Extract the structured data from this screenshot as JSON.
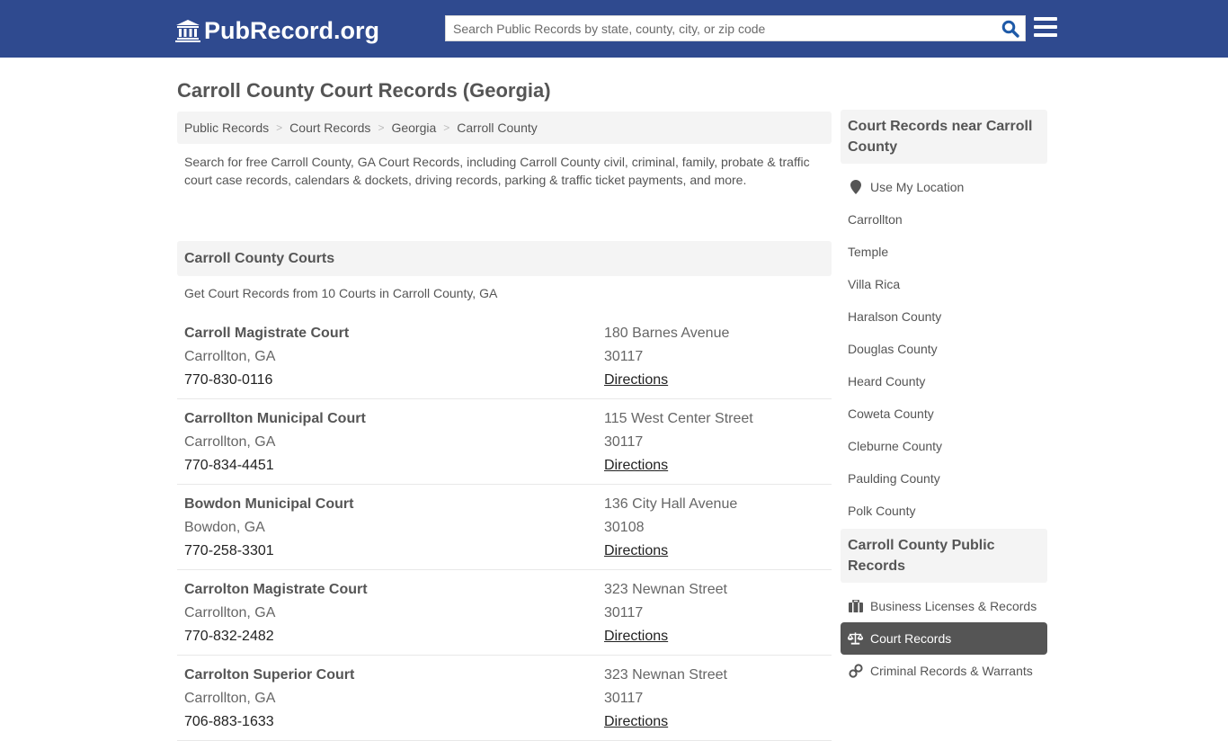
{
  "header": {
    "logo_text": "PubRecord.org",
    "search_placeholder": "Search Public Records by state, county, city, or zip code",
    "brand_color": "#2f4a8f",
    "search_icon_color": "#1e5aa8"
  },
  "page": {
    "title": "Carroll County Court Records (Georgia)"
  },
  "breadcrumb": [
    {
      "label": "Public Records"
    },
    {
      "label": "Court Records"
    },
    {
      "label": "Georgia"
    },
    {
      "label": "Carroll County"
    }
  ],
  "breadcrumb_separator": ">",
  "intro": "Search for free Carroll County, GA Court Records, including Carroll County civil, criminal, family, probate & traffic court case records, calendars & dockets, driving records, parking & traffic ticket payments, and more.",
  "courts_section": {
    "title": "Carroll County Courts",
    "subtitle": "Get Court Records from 10 Courts in Carroll County, GA",
    "courts": [
      {
        "name": "Carroll Magistrate Court",
        "city": "Carrollton, GA",
        "phone": "770-830-0116",
        "address": "180 Barnes Avenue",
        "zip": "30117",
        "directions": "Directions"
      },
      {
        "name": "Carrollton Municipal Court",
        "city": "Carrollton, GA",
        "phone": "770-834-4451",
        "address": "115 West Center Street",
        "zip": "30117",
        "directions": "Directions"
      },
      {
        "name": "Bowdon Municipal Court",
        "city": "Bowdon, GA",
        "phone": "770-258-3301",
        "address": "136 City Hall Avenue",
        "zip": "30108",
        "directions": "Directions"
      },
      {
        "name": "Carrolton Magistrate Court",
        "city": "Carrollton, GA",
        "phone": "770-832-2482",
        "address": "323 Newnan Street",
        "zip": "30117",
        "directions": "Directions"
      },
      {
        "name": "Carrolton Superior Court",
        "city": "Carrollton, GA",
        "phone": "706-883-1633",
        "address": "323 Newnan Street",
        "zip": "30117",
        "directions": "Directions"
      }
    ]
  },
  "sidebar": {
    "nearby_title": "Court Records near Carroll County",
    "use_location": "Use My Location",
    "nearby": [
      {
        "label": "Carrollton"
      },
      {
        "label": "Temple"
      },
      {
        "label": "Villa Rica"
      },
      {
        "label": "Haralson County"
      },
      {
        "label": "Douglas County"
      },
      {
        "label": "Heard County"
      },
      {
        "label": "Coweta County"
      },
      {
        "label": "Cleburne County"
      },
      {
        "label": "Paulding County"
      },
      {
        "label": "Polk County"
      }
    ],
    "public_title": "Carroll County Public Records",
    "public": [
      {
        "label": "Business Licenses & Records",
        "icon": "briefcase-icon"
      },
      {
        "label": "Court Records",
        "icon": "scale-icon",
        "active": true
      },
      {
        "label": "Criminal Records & Warrants",
        "icon": "handcuffs-icon"
      }
    ]
  }
}
